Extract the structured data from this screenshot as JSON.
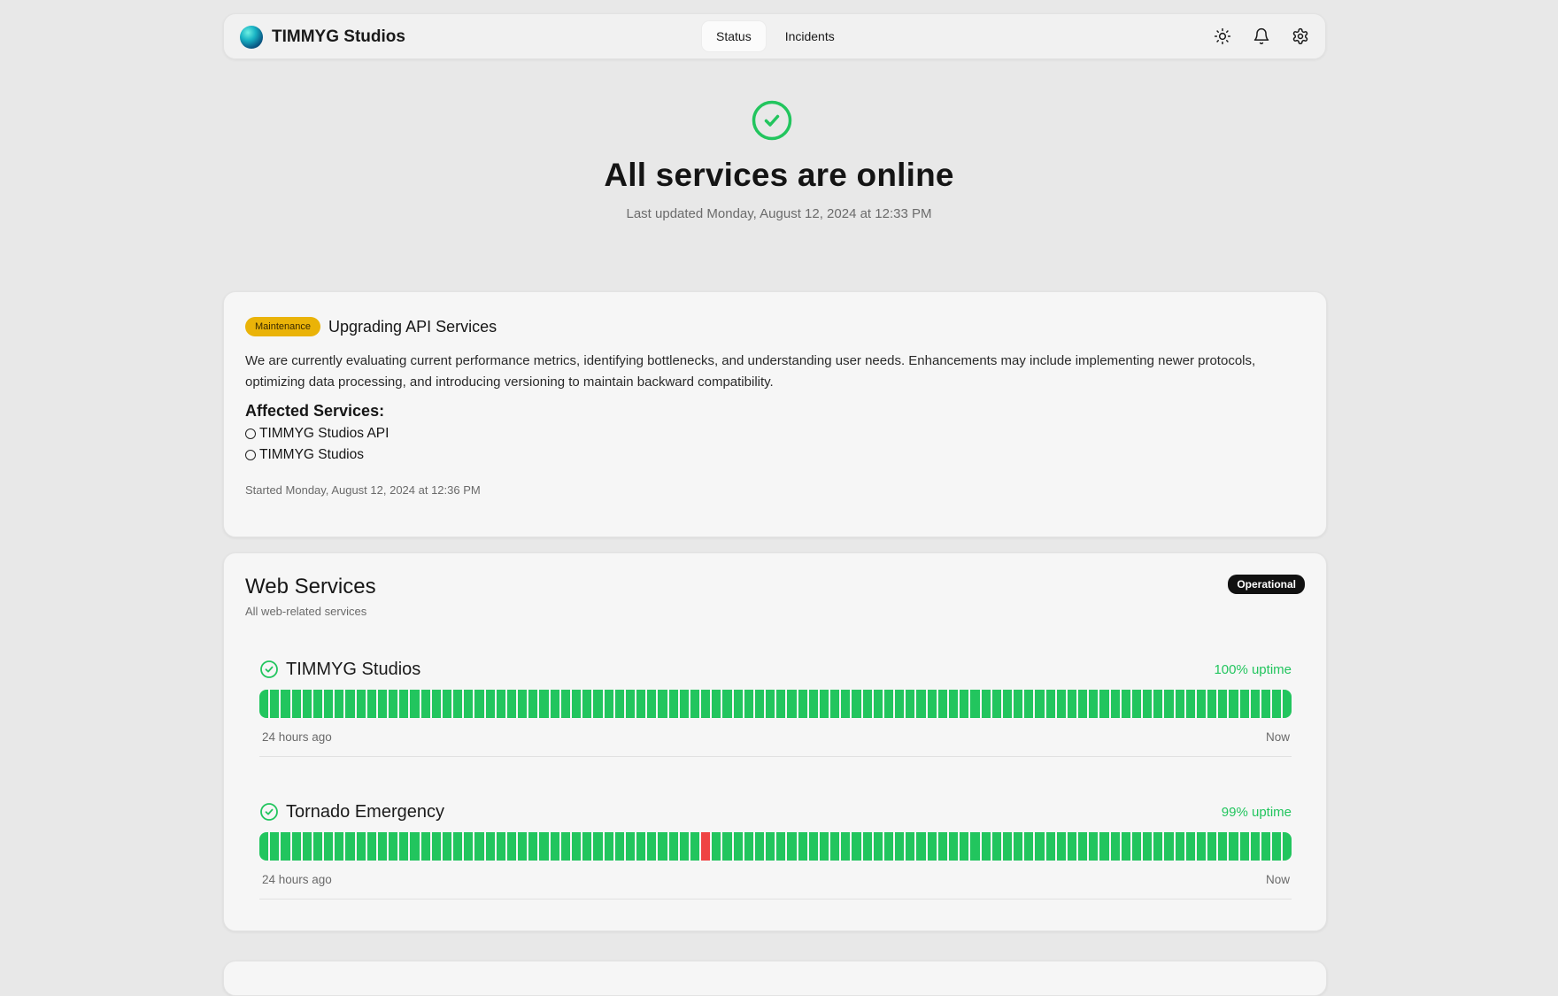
{
  "header": {
    "brand": "TIMMYG Studios",
    "tabs": [
      {
        "label": "Status",
        "active": true
      },
      {
        "label": "Incidents",
        "active": false
      }
    ],
    "icons": [
      "sun-icon",
      "bell-icon",
      "gear-icon"
    ]
  },
  "hero": {
    "title": "All services are online",
    "updated": "Last updated Monday, August 12, 2024 at 12:33 PM"
  },
  "maintenance": {
    "badge": "Maintenance",
    "title": "Upgrading API Services",
    "description": "We are currently evaluating current performance metrics, identifying bottlenecks, and understanding user needs. Enhancements may include implementing newer protocols, optimizing data processing, and introducing versioning to maintain backward compatibility.",
    "affected_title": "Affected Services:",
    "affected": [
      "TIMMYG Studios API",
      "TIMMYG Studios"
    ],
    "started": "Started Monday, August 12, 2024 at 12:36 PM"
  },
  "web_services": {
    "title": "Web Services",
    "subtitle": "All web-related services",
    "status_badge": "Operational",
    "services": [
      {
        "name": "TIMMYG Studios",
        "uptime": "100% uptime",
        "from": "24 hours ago",
        "to": "Now",
        "bar_count": 96,
        "down_bars": []
      },
      {
        "name": "Tornado Emergency",
        "uptime": "99% uptime",
        "from": "24 hours ago",
        "to": "Now",
        "bar_count": 96,
        "down_bars": [
          41
        ]
      }
    ]
  },
  "colors": {
    "operational": "#22c55e",
    "down": "#ef4444",
    "maintenance": "#eab308"
  }
}
